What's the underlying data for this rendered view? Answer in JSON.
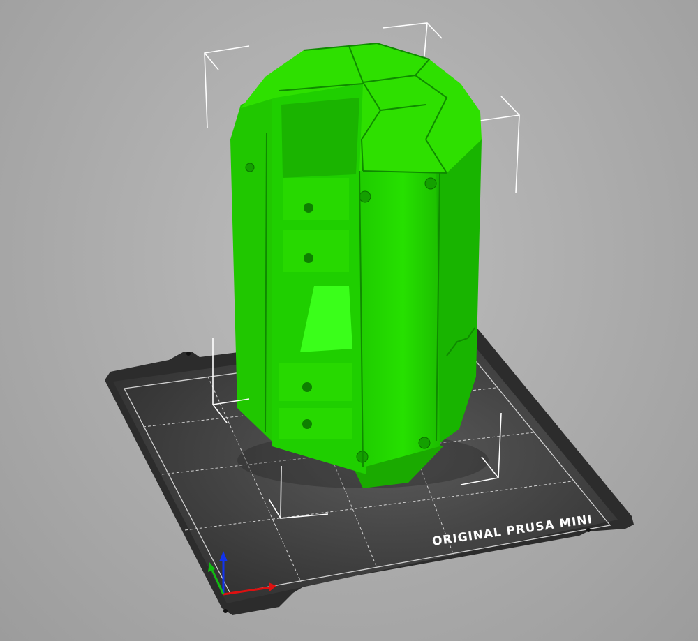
{
  "app": {
    "view": "3D build plate view"
  },
  "bed": {
    "label": "ORIGINAL PRUSA MINI",
    "surface_color": "#3a3a3a",
    "frame_color": "#2a2a2a",
    "grid_color": "#d8d8d8"
  },
  "model": {
    "color": "#22dd00",
    "shade_color": "#17a800",
    "highlight_color": "#5cff2e"
  },
  "axes": {
    "x_color": "#dd1111",
    "y_color": "#11bb11",
    "z_color": "#1133ee"
  },
  "icons": {
    "axis_gizmo": "xyz-axes-icon",
    "bounding_box": "selection-bounding-box-icon"
  }
}
